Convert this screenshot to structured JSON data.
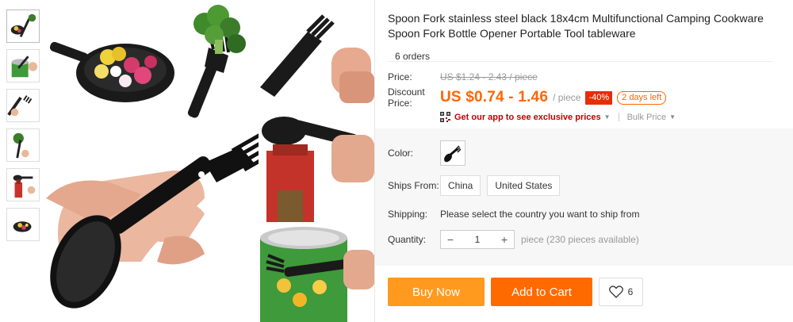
{
  "product": {
    "title": "Spoon Fork stainless steel black 18x4cm Multifunctional Camping Cookware Spoon Fork Bottle Opener Portable Tool tableware",
    "orders": "6 orders"
  },
  "price": {
    "price_label": "Price:",
    "old_price": "US $1.24 - 2.43 / piece",
    "discount_label_1": "Discount",
    "discount_label_2": "Price:",
    "new_price": "US $0.74 - 1.46",
    "per_piece": "/ piece",
    "discount_badge": "-40%",
    "days_left": "2 days left",
    "app_promo": "Get our app to see exclusive prices",
    "bulk_price": "Bulk Price"
  },
  "options": {
    "color_label": "Color:",
    "ships_from_label": "Ships From:",
    "ships_from": [
      "China",
      "United States"
    ],
    "shipping_label": "Shipping:",
    "shipping_text": "Please select the country you want to ship from",
    "quantity_label": "Quantity:",
    "quantity_value": "1",
    "quantity_minus": "−",
    "quantity_plus": "+",
    "availability": "piece (230 pieces available)"
  },
  "actions": {
    "buy_now": "Buy Now",
    "add_to_cart": "Add to Cart",
    "wishlist_count": "6"
  },
  "colors": {
    "accent_orange": "#ff6a00",
    "buy_orange": "#ff9a1f",
    "price_orange": "#ff6600",
    "discount_red": "#e62e04"
  },
  "icons": {
    "app": "qr-code-icon",
    "dropdown": "chevron-down-icon",
    "wishlist": "heart-icon"
  }
}
